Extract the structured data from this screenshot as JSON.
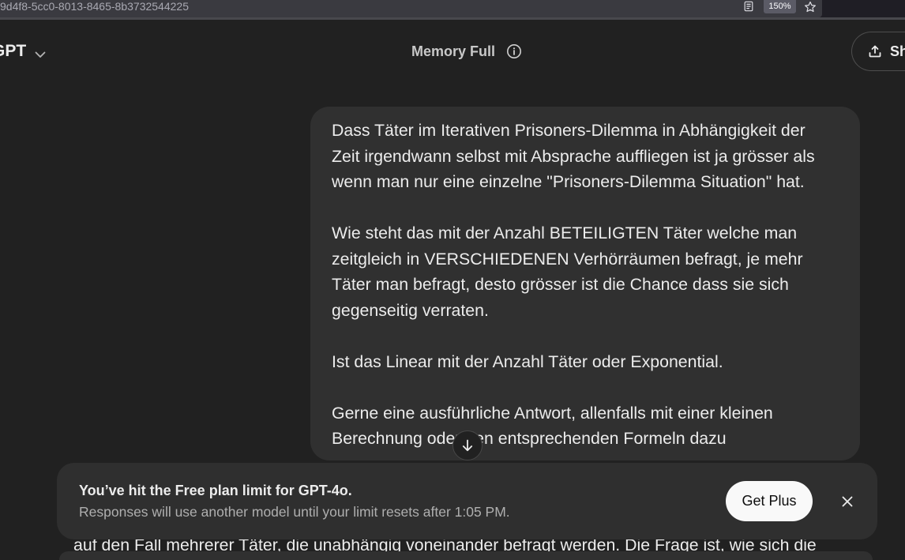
{
  "browser": {
    "url": "9d4f8-5cc0-8013-8465-8b3732544225",
    "zoom": "150%"
  },
  "header": {
    "model_label": "GPT",
    "memory_label": "Memory Full",
    "share_label": "Sh"
  },
  "message": {
    "paragraphs": [
      [
        "Dass Täter im Iterativen Prisoners-Dilemma in Abhängigkeit der",
        "Zeit irgendwann selbst mit Absprache auffliegen ist ja grösser als",
        "wenn man nur eine einzelne \"Prisoners-Dilemma Situation\" hat."
      ],
      [
        "Wie steht das mit der Anzahl BETEILIGTEN Täter welche man",
        "zeitgleich in VERSCHIEDENEN Verhörräumen befragt, je mehr",
        "Täter man befragt, desto grösser ist die Chance dass sie sich",
        "gegenseitig verraten."
      ],
      [
        "Ist das Linear mit der Anzahl Täter oder Exponential."
      ],
      [
        "Gerne eine ausführliche Antwort, allenfalls mit einer kleinen",
        "Berechnung oder den entsprechenden Formeln dazu"
      ]
    ]
  },
  "banner": {
    "title": "You’ve hit the Free plan limit for GPT-4o.",
    "subtitle": "Responses will use another model until your limit resets after 1:05 PM.",
    "button": "Get Plus"
  },
  "assistant": {
    "visible_line": "auf den Fall mehrerer Täter, die unabhängig voneinander befragt werden. Die Frage ist, wie sich die"
  },
  "icons": {
    "reader": "reader-view-icon",
    "bookmark": "bookmark-star-icon",
    "model_menu": "chevron-down-icon",
    "memory_info": "info-icon",
    "share": "share-upload-icon",
    "scroll": "arrow-down-icon",
    "close": "close-icon"
  },
  "colors": {
    "background": "#212121",
    "bubble": "#303030",
    "text": "#ececec",
    "muted_text": "#afafaf",
    "primary_button": "#f9f9f9"
  }
}
